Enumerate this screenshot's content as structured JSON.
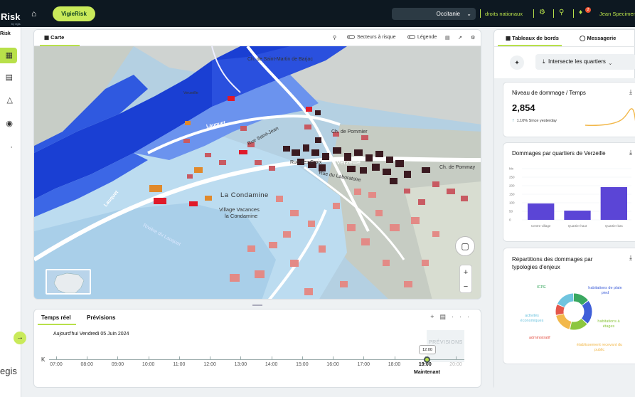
{
  "brand": {
    "name": "Risk",
    "sub": "by égis",
    "app": "Risk",
    "footer": "egis"
  },
  "topbar": {
    "app_pill": "VigieRisk",
    "region": "Occitanie",
    "link": "droits nationaux",
    "user": "Jean Specimen",
    "notifications": "2"
  },
  "map": {
    "tab": "Carte",
    "secteurs": "Secteurs à risque",
    "legende": "Légende",
    "labels": {
      "ch_saint": "Ch. de Saint-Martin de Barjac",
      "verzeille_small": "Verzeille",
      "lauquet1": "Lauquet",
      "lauquet2": "Lauquet",
      "rue_saint": "Rue Saint-Jean",
      "rue_croix": "Rue des Croix",
      "ch_pommier": "Ch. de Pommier",
      "laboratoire": "Rue du Laboratoire",
      "verzeille": "Verzeille",
      "ch_pommay": "Ch. de Pommay",
      "condamine": "La Condamine",
      "village": "Village Vacances",
      "village2": "la Condamine",
      "riviere": "Rivière du Lauquet"
    }
  },
  "timeline": {
    "tab_realtime": "Temps réel",
    "tab_forecast": "Prévisions",
    "date": "Aujourd'hui Vendredi 05 Juin 2024",
    "hours": [
      "07:00",
      "08:00",
      "09:00",
      "10:00",
      "11:00",
      "12:00",
      "13:00",
      "14:00",
      "15:00",
      "16:00",
      "17:00",
      "18:00",
      "19:00",
      "20:00"
    ],
    "forecast_label": "PRÉVISIONS",
    "now_time": "12:00",
    "now_label": "Maintenant"
  },
  "panel": {
    "tab_dashboards": "Tableaux de bords",
    "tab_messages": "Messagerie",
    "select": "Intersecte les quartiers",
    "kpi": {
      "title": "Niveau de dommage / Temps",
      "value": "2,854",
      "since": "1.10% Since yesterday"
    },
    "bars": {
      "title": "Dommages par quartiers de Verzeille"
    },
    "donut": {
      "title": "Répartitions des dommages par typologies d'enjeux"
    }
  },
  "chart_data": [
    {
      "type": "bar",
      "categories": [
        "Centre village",
        "Quartier haut",
        "Quartier bas"
      ],
      "values": [
        80,
        45,
        160
      ],
      "y_ticks": [
        "Mx",
        "250",
        "200",
        "150",
        "100",
        "50",
        "0"
      ],
      "ylim": [
        0,
        250
      ],
      "title": "Dommages par quartiers de Verzeille",
      "color": "#5b45d6"
    },
    {
      "type": "pie",
      "categories": [
        "ICPE",
        "habitations de plain pied",
        "habitations à étages",
        "établissement recevant du public",
        "administratif",
        "activités économiques"
      ],
      "values": [
        15,
        22,
        17,
        18,
        10,
        18
      ],
      "colors": [
        "#3aa860",
        "#3f5fd8",
        "#8cc63f",
        "#f2b84b",
        "#e4564a",
        "#6fc4df"
      ],
      "title": "Répartitions des dommages par typologies d'enjeux"
    }
  ]
}
